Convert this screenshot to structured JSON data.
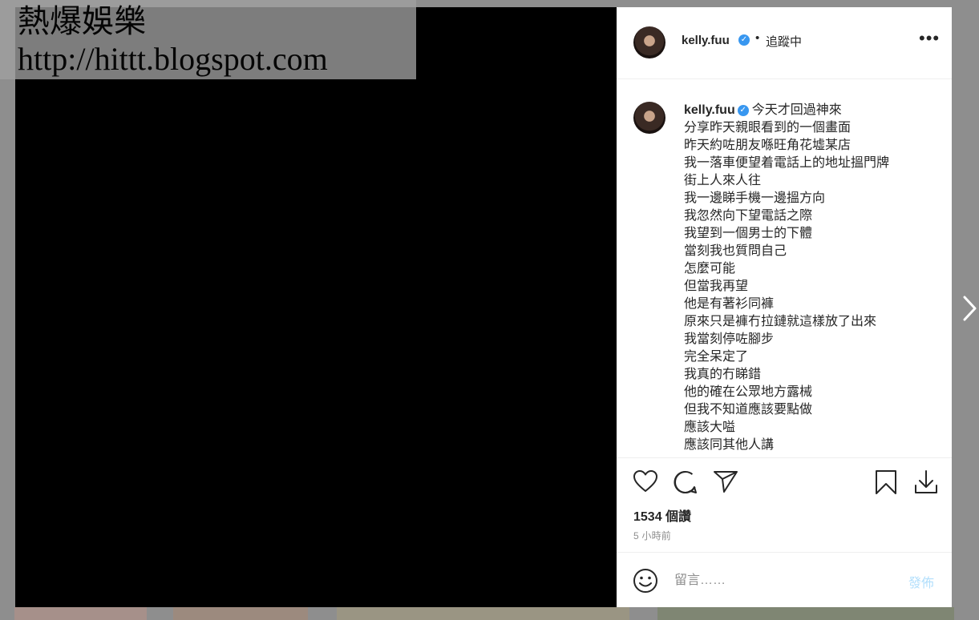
{
  "watermark": {
    "title": "熱爆娛樂",
    "url": "http://hittt.blogspot.com"
  },
  "header": {
    "username": "kelly.fuu",
    "verified_icon": "verified-badge-icon",
    "separator": "•",
    "follow_status": "追蹤中",
    "more_label": "•••"
  },
  "caption": {
    "username": "kelly.fuu",
    "first_line": "今天才回過神來",
    "lines": [
      "分享昨天親眼看到的一個畫面",
      "昨天約咗朋友喺旺角花墟某店",
      "我一落車便望着電話上的地址搵門牌",
      "街上人來人往",
      "我一邊睇手機一邊搵方向",
      "我忽然向下望電話之際",
      "我望到一個男士的下體",
      "當刻我也質問自己",
      "怎麼可能",
      "但當我再望",
      "他是有著衫同褲",
      "原來只是褲冇拉鏈就這樣放了出來",
      "我當刻停咗腳步",
      "完全呆定了",
      "我真的冇睇錯",
      "他的確在公眾地方露械",
      "但我不知道應該要點做",
      "應該大嗌",
      "應該同其他人講"
    ]
  },
  "actions": {
    "icons": [
      "heart-icon",
      "comment-icon",
      "share-icon",
      "bookmark-icon",
      "download-icon"
    ]
  },
  "likes": "1534 個讚",
  "time": "5 小時前",
  "comment": {
    "placeholder": "留言……",
    "post_label": "發佈"
  },
  "colors": {
    "accent": "#3897f0",
    "post_disabled": "#b2dffc",
    "text": "#262626",
    "muted": "#8e8e8e"
  }
}
